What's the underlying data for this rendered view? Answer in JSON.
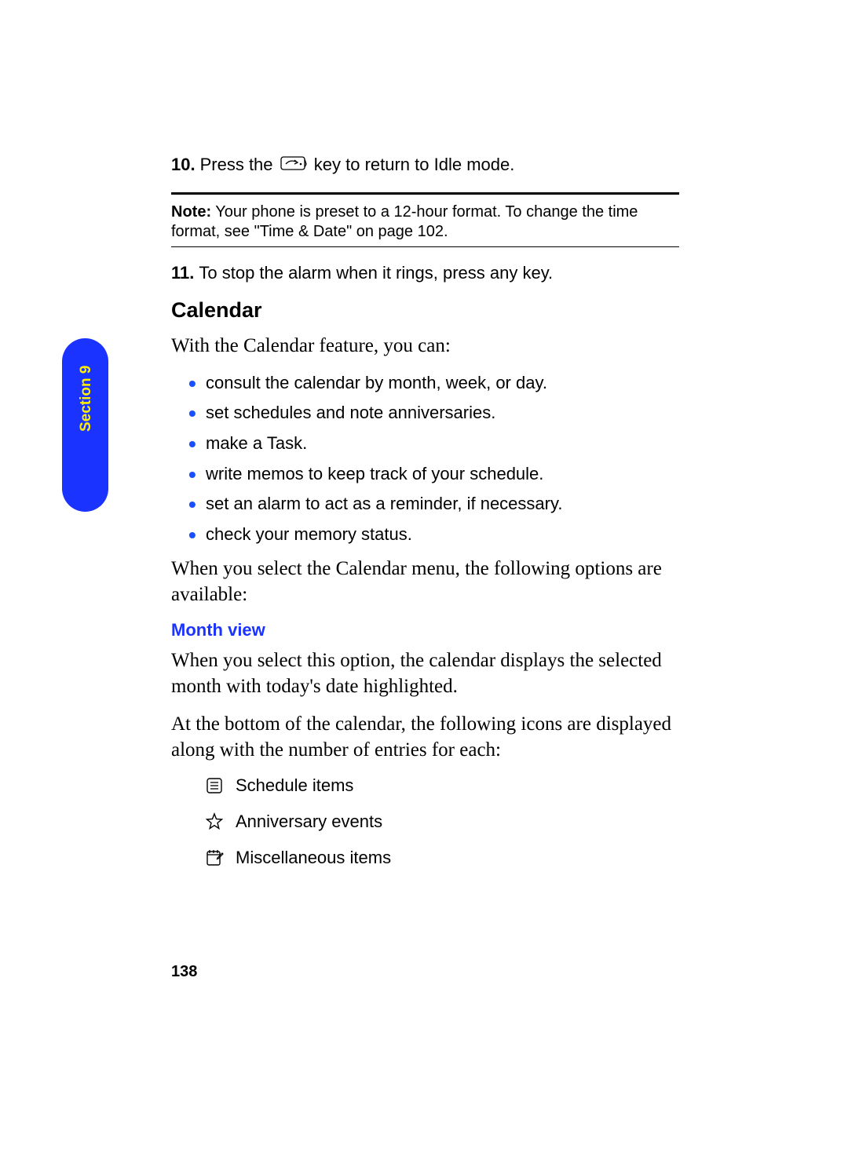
{
  "side_tab": {
    "label": "Section 9"
  },
  "step10": {
    "num": "10.",
    "text_before": "Press the ",
    "text_after": " key to return to Idle mode."
  },
  "note": {
    "label": "Note:",
    "text": " Your phone is preset to a 12-hour format. To change the time format, see \"Time & Date\" on page 102."
  },
  "step11": {
    "num": "11.",
    "text": "To stop the alarm when it rings, press any key."
  },
  "heading": "Calendar",
  "intro": "With the Calendar feature, you can:",
  "bullets": [
    "consult the calendar by month, week, or day.",
    "set schedules and note anniversaries.",
    "make a Task.",
    "write memos to keep track of your schedule.",
    "set an alarm to act as a reminder, if necessary.",
    "check your memory status."
  ],
  "menu_intro": "When you select the Calendar menu, the following options are available:",
  "subheading": "Month view",
  "month_para1": "When you select this option, the calendar displays the selected month with today's date highlighted.",
  "month_para2": "At the bottom of the calendar, the following icons are displayed along with the number of entries for each:",
  "icons_list": [
    {
      "name": "schedule-icon",
      "label": "Schedule items"
    },
    {
      "name": "anniversary-icon",
      "label": "Anniversary events"
    },
    {
      "name": "misc-icon",
      "label": "Miscellaneous items"
    }
  ],
  "page_number": "138"
}
